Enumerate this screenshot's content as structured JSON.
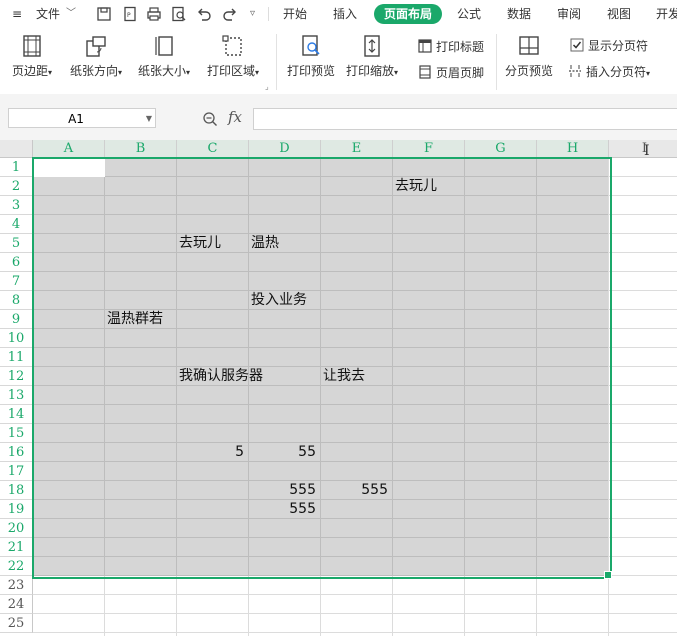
{
  "menubar": {
    "file_label": "文件",
    "tabs": [
      "开始",
      "插入",
      "页面布局",
      "公式",
      "数据",
      "审阅",
      "视图",
      "开发"
    ],
    "active_tab": "页面布局"
  },
  "ribbon": {
    "margins": "页边距",
    "orientation": "纸张方向",
    "paper_size": "纸张大小",
    "print_area": "打印区域",
    "print_preview": "打印预览",
    "print_scale": "打印缩放",
    "print_titles": "打印标题",
    "header_footer": "页眉页脚",
    "page_break_preview": "分页预览",
    "show_page_breaks": "显示分页符",
    "insert_page_break": "插入分页符"
  },
  "formula_bar": {
    "name_box": "A1",
    "fx_label": "fx",
    "formula": ""
  },
  "sheet": {
    "columns": [
      "A",
      "B",
      "C",
      "D",
      "E",
      "F",
      "G",
      "H",
      "I"
    ],
    "rows": [
      "1",
      "2",
      "3",
      "4",
      "5",
      "6",
      "7",
      "8",
      "9",
      "10",
      "11",
      "12",
      "13",
      "14",
      "15",
      "16",
      "17",
      "18",
      "19",
      "20",
      "21",
      "22",
      "23",
      "24",
      "25"
    ],
    "cells": {
      "F2": "去玩儿",
      "C5": "去玩儿",
      "D5": "温热",
      "D8": "投入业务",
      "B9": "温热群若",
      "C12": "我确认服务器",
      "E12": "让我去",
      "C16": "5",
      "D16": "55",
      "D18": "555",
      "E18": "555",
      "D19": "555"
    }
  },
  "colors": {
    "accent": "#1aa86a",
    "selection_fill": "#d6d6d6"
  }
}
